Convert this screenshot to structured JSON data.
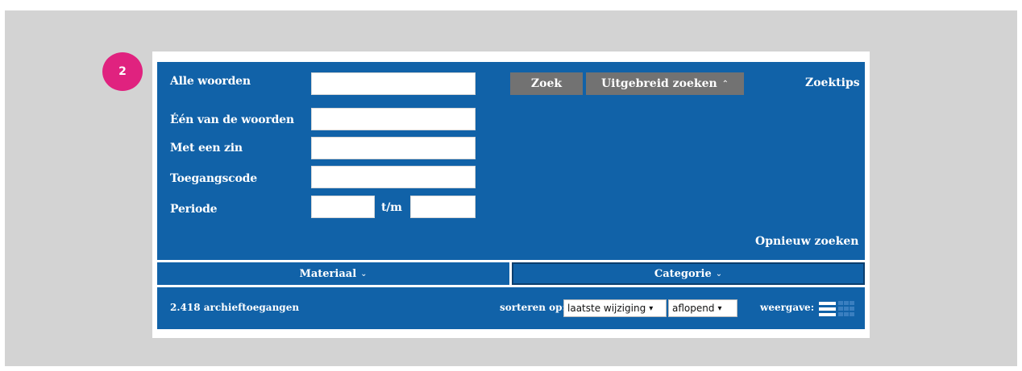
{
  "step_badge": "2",
  "form": {
    "all_words_label": "Alle woorden",
    "one_of_words_label": "Één van de woorden",
    "phrase_label": "Met een zin",
    "access_code_label": "Toegangscode",
    "period_label": "Periode",
    "period_separator": "t/m",
    "all_words_value": "",
    "one_of_words_value": "",
    "phrase_value": "",
    "access_code_value": "",
    "period_from_value": "",
    "period_to_value": ""
  },
  "buttons": {
    "search": "Zoek",
    "advanced_search": "Uitgebreid zoeken",
    "advanced_chevron": "⌃",
    "search_tips": "Zoektips",
    "new_search": "Opnieuw zoeken"
  },
  "tabs": [
    {
      "label": "Materiaal",
      "chevron": "⌄"
    },
    {
      "label": "Categorie",
      "chevron": "⌄"
    }
  ],
  "results": {
    "count_text": "2.418 archieftoegangen",
    "sort_label": "sorteren op:",
    "sort_field": "laatste wijziging",
    "sort_order": "aflopend",
    "view_label": "weergave:"
  },
  "icons": {
    "list_view": "list-view-icon",
    "grid_view": "grid-view-icon"
  },
  "colors": {
    "panel_blue": "#1162a8",
    "button_gray": "#727272",
    "badge_pink": "#e0227f"
  }
}
